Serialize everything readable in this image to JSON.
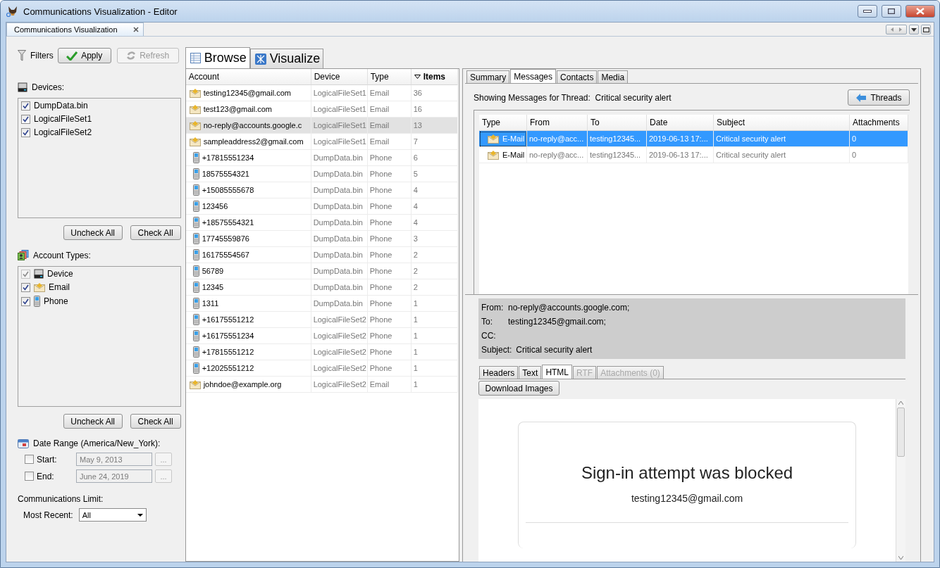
{
  "window": {
    "title": "Communications Visualization - Editor"
  },
  "doc_tab": {
    "label": "Communications Visualization"
  },
  "filters": {
    "label": "Filters",
    "apply": "Apply",
    "refresh": "Refresh",
    "refresh_disabled": true
  },
  "devices": {
    "label": "Devices:",
    "items": [
      {
        "label": "DumpData.bin",
        "checked": true
      },
      {
        "label": "LogicalFileSet1",
        "checked": true
      },
      {
        "label": "LogicalFileSet2",
        "checked": true
      }
    ],
    "uncheck_all": "Uncheck All",
    "check_all": "Check All"
  },
  "account_types": {
    "label": "Account Types:",
    "items": [
      {
        "label": "Device",
        "kind": "device",
        "checked": true,
        "disabled": true
      },
      {
        "label": "Email",
        "kind": "email",
        "checked": true,
        "disabled": false
      },
      {
        "label": "Phone",
        "kind": "phone",
        "checked": true,
        "disabled": false
      }
    ],
    "uncheck_all": "Uncheck All",
    "check_all": "Check All"
  },
  "date_range": {
    "label": "Date Range (America/New_York):",
    "fields": [
      {
        "label": "Start:",
        "checked": false,
        "value": "May 9, 2013",
        "button": "..."
      },
      {
        "label": "End:",
        "checked": false,
        "value": "June 24, 2019",
        "button": "..."
      }
    ]
  },
  "limit": {
    "label": "Communications Limit:",
    "field_label": "Most Recent:",
    "value": "All"
  },
  "view_tabs": [
    {
      "label": "Browse",
      "kind": "table",
      "selected": true
    },
    {
      "label": "Visualize",
      "kind": "graph",
      "selected": false
    }
  ],
  "accounts": {
    "columns": [
      {
        "label": "Account",
        "sorted": false
      },
      {
        "label": "Device",
        "sorted": false
      },
      {
        "label": "Type",
        "sorted": false
      },
      {
        "label": "Items",
        "sorted": true
      }
    ],
    "rows": [
      {
        "kind": "email",
        "account": "testing12345@gmail.com",
        "device": "LogicalFileSet1",
        "type": "Email",
        "items": "36",
        "selected": false
      },
      {
        "kind": "email",
        "account": "test123@gmail.com",
        "device": "LogicalFileSet1",
        "type": "Email",
        "items": "16",
        "selected": false
      },
      {
        "kind": "email",
        "account": "no-reply@accounts.google.c",
        "device": "LogicalFileSet1",
        "type": "Email",
        "items": "13",
        "selected": true
      },
      {
        "kind": "email",
        "account": "sampleaddress2@gmail.com",
        "device": "LogicalFileSet1",
        "type": "Email",
        "items": "7",
        "selected": false
      },
      {
        "kind": "phone",
        "account": "+17815551234",
        "device": "DumpData.bin",
        "type": "Phone",
        "items": "6",
        "selected": false
      },
      {
        "kind": "phone",
        "account": "18575554321",
        "device": "DumpData.bin",
        "type": "Phone",
        "items": "5",
        "selected": false
      },
      {
        "kind": "phone",
        "account": "+15085555678",
        "device": "DumpData.bin",
        "type": "Phone",
        "items": "4",
        "selected": false
      },
      {
        "kind": "phone",
        "account": "123456",
        "device": "DumpData.bin",
        "type": "Phone",
        "items": "4",
        "selected": false
      },
      {
        "kind": "phone",
        "account": "+18575554321",
        "device": "DumpData.bin",
        "type": "Phone",
        "items": "4",
        "selected": false
      },
      {
        "kind": "phone",
        "account": "17745559876",
        "device": "DumpData.bin",
        "type": "Phone",
        "items": "3",
        "selected": false
      },
      {
        "kind": "phone",
        "account": "16175554567",
        "device": "DumpData.bin",
        "type": "Phone",
        "items": "2",
        "selected": false
      },
      {
        "kind": "phone",
        "account": "56789",
        "device": "DumpData.bin",
        "type": "Phone",
        "items": "2",
        "selected": false
      },
      {
        "kind": "phone",
        "account": "12345",
        "device": "DumpData.bin",
        "type": "Phone",
        "items": "2",
        "selected": false
      },
      {
        "kind": "phone",
        "account": "1311",
        "device": "DumpData.bin",
        "type": "Phone",
        "items": "1",
        "selected": false
      },
      {
        "kind": "phone",
        "account": "+16175551212",
        "device": "LogicalFileSet2",
        "type": "Phone",
        "items": "1",
        "selected": false
      },
      {
        "kind": "phone",
        "account": "+16175551234",
        "device": "LogicalFileSet2",
        "type": "Phone",
        "items": "1",
        "selected": false
      },
      {
        "kind": "phone",
        "account": "+17815551212",
        "device": "LogicalFileSet2",
        "type": "Phone",
        "items": "1",
        "selected": false
      },
      {
        "kind": "phone",
        "account": "+12025551212",
        "device": "LogicalFileSet2",
        "type": "Phone",
        "items": "1",
        "selected": false
      },
      {
        "kind": "email",
        "account": "johndoe@example.org",
        "device": "LogicalFileSet2",
        "type": "Email",
        "items": "1",
        "selected": false
      }
    ]
  },
  "detail_tabs": [
    {
      "label": "Summary",
      "selected": false
    },
    {
      "label": "Messages",
      "selected": true
    },
    {
      "label": "Contacts",
      "selected": false
    },
    {
      "label": "Media",
      "selected": false
    }
  ],
  "thread": {
    "label": "Showing Messages for Thread:",
    "subject": "Critical security alert",
    "back_button": "Threads"
  },
  "messages": {
    "columns": [
      "Type",
      "From",
      "To",
      "Date",
      "Subject",
      "Attachments"
    ],
    "rows": [
      {
        "type": "E-Mail",
        "from": "no-reply@acc...",
        "to": "testing12345...",
        "date": "2019-06-13 17:...",
        "subject": "Critical security alert",
        "attachments": "0",
        "selected": true
      },
      {
        "type": "E-Mail",
        "from": "no-reply@acc...",
        "to": "testing12345...",
        "date": "2019-06-13 17:...",
        "subject": "Critical security alert",
        "attachments": "0",
        "selected": false
      }
    ]
  },
  "headers": [
    {
      "label": "From:",
      "value": "no-reply@accounts.google.com;"
    },
    {
      "label": "To:",
      "value": "testing12345@gmail.com;"
    },
    {
      "label": "CC:"
    },
    {
      "label": "Subject:",
      "value": "Critical security alert"
    }
  ],
  "body_tabs": [
    {
      "label": "Headers",
      "selected": false,
      "disabled": false
    },
    {
      "label": "Text",
      "selected": false,
      "disabled": false
    },
    {
      "label": "HTML",
      "selected": true,
      "disabled": false
    },
    {
      "label": "RTF",
      "selected": false,
      "disabled": true
    },
    {
      "label": "Attachments (0)",
      "selected": false,
      "disabled": true
    }
  ],
  "download_button": "Download Images",
  "email_body": {
    "heading": "Sign-in attempt was blocked",
    "address": "testing12345@gmail.com"
  }
}
